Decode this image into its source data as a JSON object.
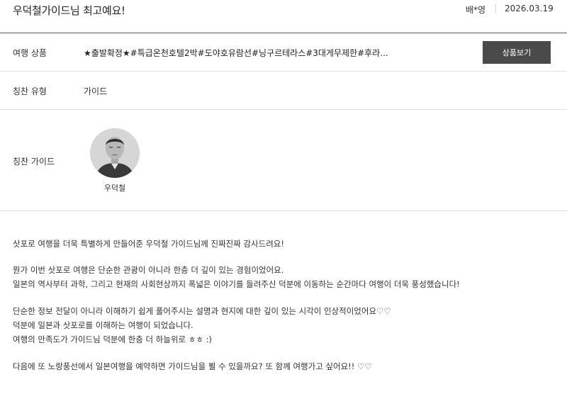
{
  "review": {
    "title": "우덕철가이드님 최고예요!",
    "author": "배*영",
    "date": "2026.03.19"
  },
  "product": {
    "label": "여행 상품",
    "name": "★출발확정★#특급온천호텔2박#도야호유람선#닝구르테라스#3대게무제한#후라...",
    "button_label": "상품보기"
  },
  "praise_type": {
    "label": "칭찬 유형",
    "value": "가이드"
  },
  "praised_guide": {
    "label": "칭찬 가이드",
    "name": "우덕철"
  },
  "content": {
    "line1": "삿포로 여행을 더욱 특별하게 만들어준 우덕철 가이드님께 진짜진짜 감사드려요!",
    "line2": "뭔가 이번 삿포로 여행은 단순한 관광이 아니라 한층 더 깊이 있는 경험이었어요.",
    "line3": "일본의 역사부터 과학, 그리고 현재의 사회현상까지 폭넓은 이야기를 들려주신 덕분에 이동하는 순간마다 여행이 더욱 풍성했습니다!",
    "line4": "단순한 정보 전달이 아니라 이해하기 쉽게 풀어주시는 설명과 현지에 대한 깊이 있는 시각이 인상적이었어요♡♡",
    "line5": "덕분에 일본과 삿포로를 이해하는 여행이 되었습니다.",
    "line6": "여행의 만족도가 가이드님 덕분에 한층 더 하늘위로 ㅎㅎ :)",
    "line7": "다음에 또 노랑풍선에서 일본여행을 예약하면 가이드님을 뵐 수 있을까요? 또 함께 여행가고 싶어요!! ♡♡"
  }
}
